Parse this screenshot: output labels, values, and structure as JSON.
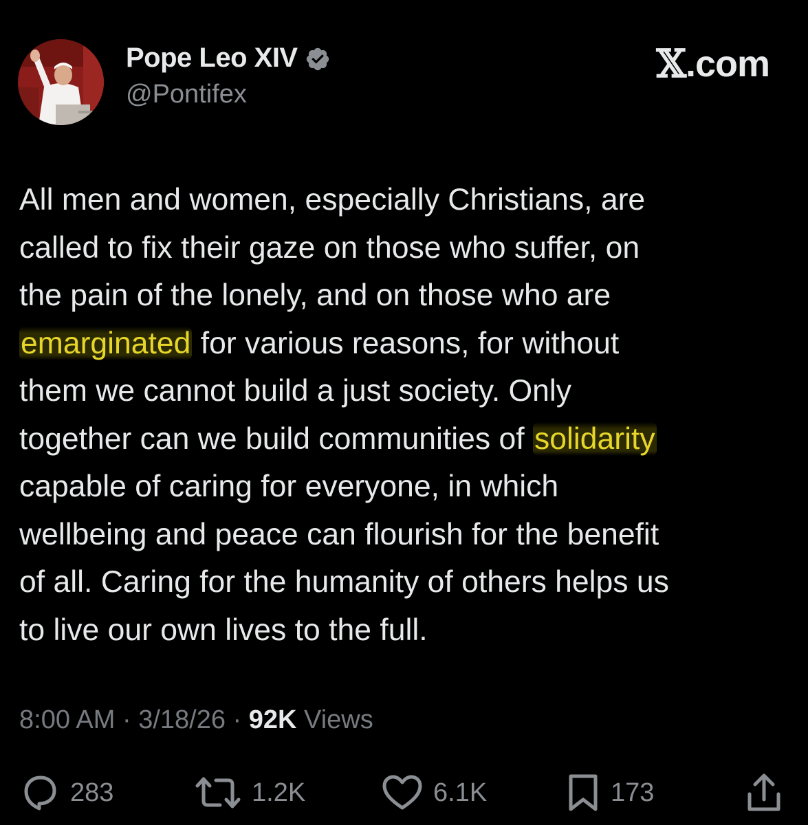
{
  "header": {
    "display_name": "Pope Leo XIV",
    "handle": "@Pontifex",
    "brand_x": "𝕏",
    "brand_suffix": ".com",
    "verified_color": "#8b8f94",
    "avatar_icon": "avatar-photo"
  },
  "tweet": {
    "lines": [
      {
        "parts": [
          {
            "text": "All men and women, especially Christians, are",
            "highlight": false
          }
        ]
      },
      {
        "parts": [
          {
            "text": "called to fix their gaze on those who suffer, on",
            "highlight": false
          }
        ]
      },
      {
        "parts": [
          {
            "text": "the pain of the lonely, and on those who are",
            "highlight": false
          }
        ]
      },
      {
        "parts": [
          {
            "text": "emarginated",
            "highlight": true
          },
          {
            "text": " for various reasons, for without",
            "highlight": false
          }
        ]
      },
      {
        "parts": [
          {
            "text": "them we cannot build a just society. Only",
            "highlight": false
          }
        ]
      },
      {
        "parts": [
          {
            "text": "together can we build communities of ",
            "highlight": false
          },
          {
            "text": "solidarity",
            "highlight": true
          }
        ]
      },
      {
        "parts": [
          {
            "text": "capable of caring for everyone, in which",
            "highlight": false
          }
        ]
      },
      {
        "parts": [
          {
            "text": "wellbeing and peace can flourish for the benefit",
            "highlight": false
          }
        ]
      },
      {
        "parts": [
          {
            "text": "of all. Caring for the humanity of others helps us",
            "highlight": false
          }
        ]
      },
      {
        "parts": [
          {
            "text": "to live our own lives to the full.",
            "highlight": false
          }
        ]
      }
    ],
    "highlight_color": "#e6d52a"
  },
  "meta": {
    "time": "8:00 AM",
    "sep1": " · ",
    "date": "3/18/26",
    "sep2": " · ",
    "views_count": "92K",
    "views_label": " Views"
  },
  "actions": {
    "replies": {
      "icon": "reply-icon",
      "count": "283"
    },
    "reposts": {
      "icon": "repost-icon",
      "count": "1.2K"
    },
    "likes": {
      "icon": "like-icon",
      "count": "6.1K"
    },
    "bookmarks": {
      "icon": "bookmark-icon",
      "count": "173"
    },
    "share": {
      "icon": "share-icon"
    }
  }
}
